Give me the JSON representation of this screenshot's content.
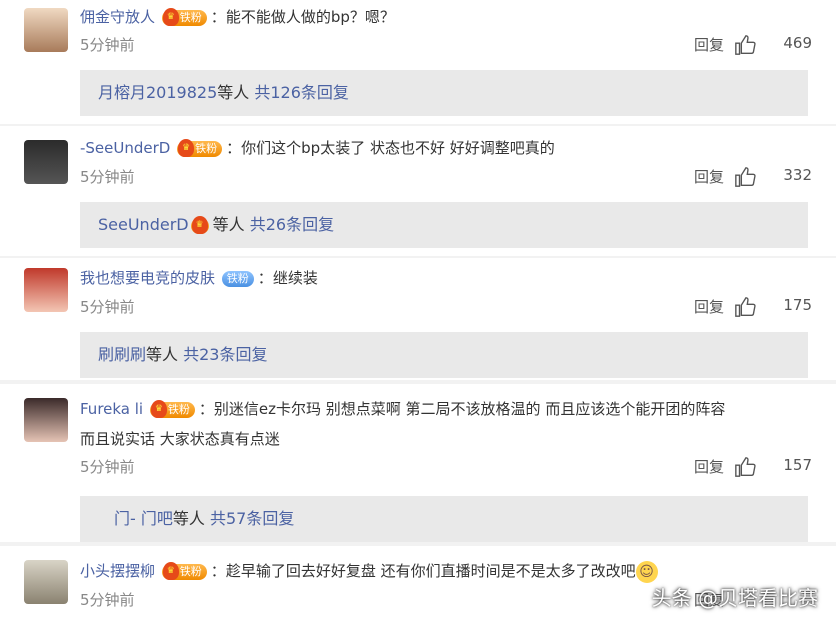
{
  "comments": [
    {
      "username": "佣金守放人",
      "badge": "铁粉",
      "text": "能不能做人做的bp？嗯？",
      "time": "5分钟前",
      "reply_label": "回复",
      "likes": "469",
      "summary": {
        "who": "月榕月2019825",
        "tail": "等人",
        "count": "共126条回复"
      }
    },
    {
      "username": "-SeeUnderD",
      "badge": "铁粉",
      "text": "你们这个bp太装了 状态也不好 好好调整吧真的",
      "time": "5分钟前",
      "reply_label": "回复",
      "likes": "332",
      "summary": {
        "who": "SeeUnderD",
        "tail": "等人",
        "count": "共26条回复"
      }
    },
    {
      "username": "我也想要电竞的皮肤",
      "badge": "铁粉",
      "text": "继续装",
      "time": "5分钟前",
      "reply_label": "回复",
      "likes": "175",
      "summary": {
        "who": "刷刷刷",
        "tail": "等人",
        "count": "共23条回复"
      }
    },
    {
      "username": "Fureka li",
      "badge": "铁粉",
      "text": "别迷信ez卡尔玛 别想点菜啊 第二局不该放格温的 而且应该选个能开团的阵容",
      "text2": "而且说实话 大家状态真有点迷",
      "time": "5分钟前",
      "reply_label": "回复",
      "likes": "157",
      "summary": {
        "who": "门- 门吧",
        "tail": "等人",
        "count": "共57条回复"
      }
    },
    {
      "username": "小头摆摆柳",
      "badge": "铁粉",
      "text": "趁早输了回去好好复盘 还有你们直播时间是不是太多了改改吧",
      "time": "5分钟前",
      "reply_label": "回复"
    }
  ],
  "watermark": "头条 @贝塔看比赛"
}
